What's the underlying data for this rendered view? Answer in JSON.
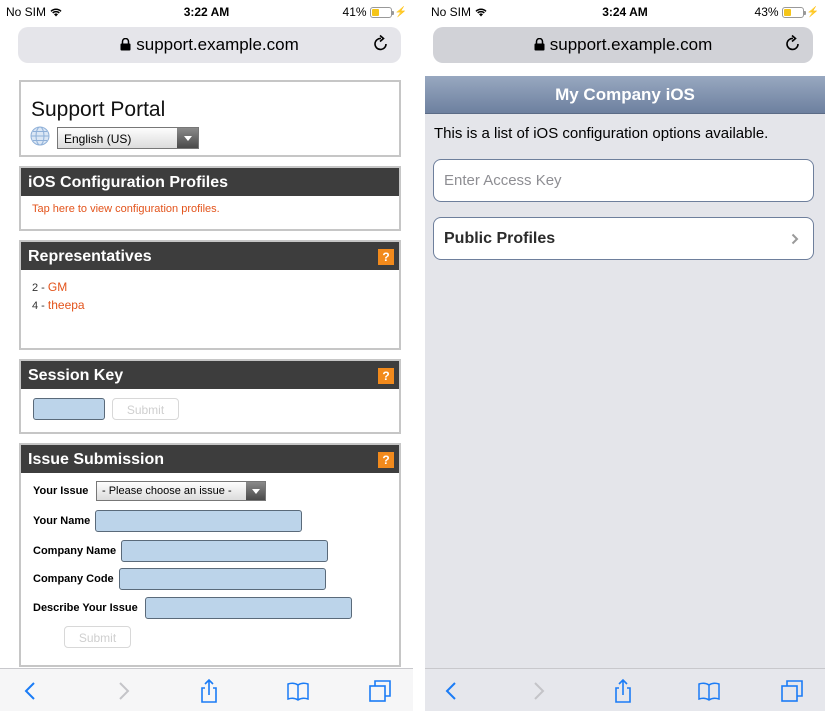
{
  "left": {
    "status": {
      "carrier": "No SIM",
      "time": "3:22 AM",
      "battery_percent": "41%",
      "battery_level": 0.41
    },
    "url": "support.example.com",
    "portal": {
      "title": "Support Portal",
      "language": "English (US)"
    },
    "ios_profiles": {
      "title": "iOS Configuration Profiles",
      "link": "Tap here to view configuration profiles."
    },
    "representatives": {
      "title": "Representatives",
      "help": "?",
      "items": [
        {
          "prefix": "2 - ",
          "name": "GM"
        },
        {
          "prefix": "4 - ",
          "name": "theepa"
        }
      ]
    },
    "session_key": {
      "title": "Session Key",
      "help": "?",
      "submit": "Submit",
      "value": ""
    },
    "issue": {
      "title": "Issue Submission",
      "help": "?",
      "your_issue_label": "Your Issue",
      "issue_select": "- Please choose an issue -",
      "your_name_label": "Your Name",
      "company_name_label": "Company Name",
      "company_code_label": "Company Code",
      "describe_label": "Describe Your Issue",
      "submit": "Submit"
    }
  },
  "right": {
    "status": {
      "carrier": "No SIM",
      "time": "3:24 AM",
      "battery_percent": "43%",
      "battery_level": 0.43
    },
    "url": "support.example.com",
    "header_title": "My Company iOS",
    "description": "This is a list of iOS configuration options available.",
    "access_key_placeholder": "Enter Access Key",
    "public_profiles": "Public Profiles"
  },
  "colors": {
    "accent_link": "#e3541c",
    "help_badge": "#f28a1c",
    "panel_header": "#3d3d3d",
    "field_fill": "#bcd4ea",
    "ios_header": "#7d8fac"
  },
  "icons": [
    "wifi-icon",
    "battery-icon",
    "lock-icon",
    "reload-icon",
    "globe-icon",
    "back-icon",
    "forward-icon",
    "share-icon",
    "bookmarks-icon",
    "tabs-icon",
    "chevron-right-icon"
  ]
}
